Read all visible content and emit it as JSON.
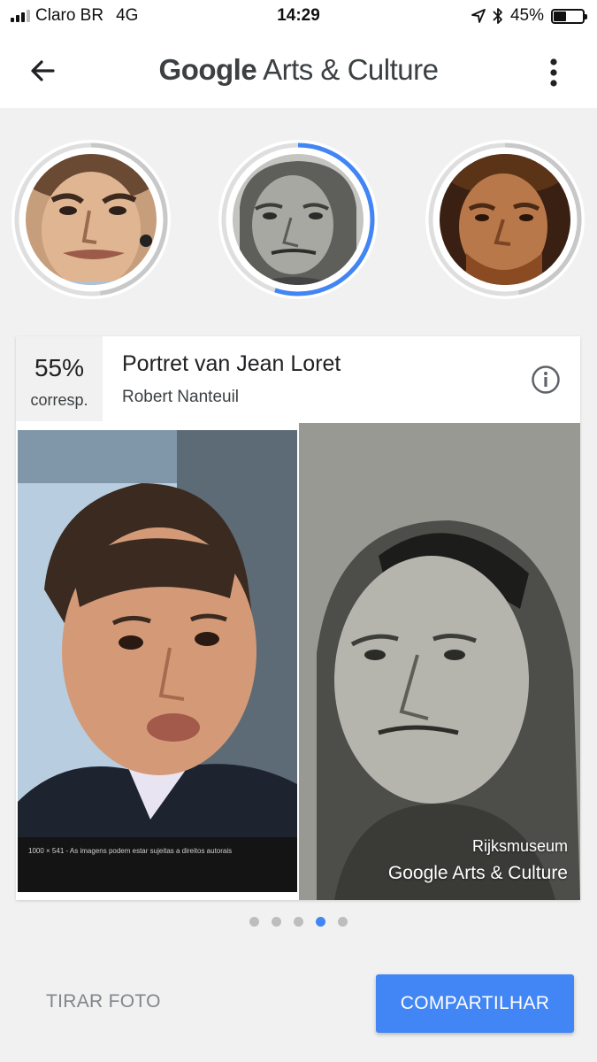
{
  "status_bar": {
    "carrier": "Claro BR",
    "network": "4G",
    "time": "14:29",
    "battery": "45%",
    "battery_level": 0.45,
    "icons": [
      "signal-icon",
      "location-arrow-icon",
      "bluetooth-icon",
      "battery-icon"
    ]
  },
  "app_bar": {
    "title_brand": "Google",
    "title_rest": "Arts & Culture",
    "icons": [
      "back-arrow-icon",
      "more-vert-icon"
    ]
  },
  "matches": [
    {
      "selected": false,
      "progress": 0.48
    },
    {
      "selected": true,
      "progress": 0.55
    },
    {
      "selected": false,
      "progress": 0.47
    }
  ],
  "card": {
    "match_percent": "55%",
    "match_label": "corresp.",
    "artwork_title": "Portret van Jean Loret",
    "artist": "Robert Nanteuil",
    "photo_caption": "1000 × 541 - As imagens podem estar sujeitas a direitos autorais",
    "credit_museum": "Rijksmuseum",
    "credit_brand": "Google Arts & Culture",
    "info_icon": "info-icon"
  },
  "pagination": {
    "count": 5,
    "active_index": 3
  },
  "actions": {
    "take_photo": "TIRAR FOTO",
    "share": "COMPARTILHAR"
  },
  "colors": {
    "accent": "#4285f4",
    "background": "#f1f1f1",
    "ring_track": "#c8c8c8"
  }
}
